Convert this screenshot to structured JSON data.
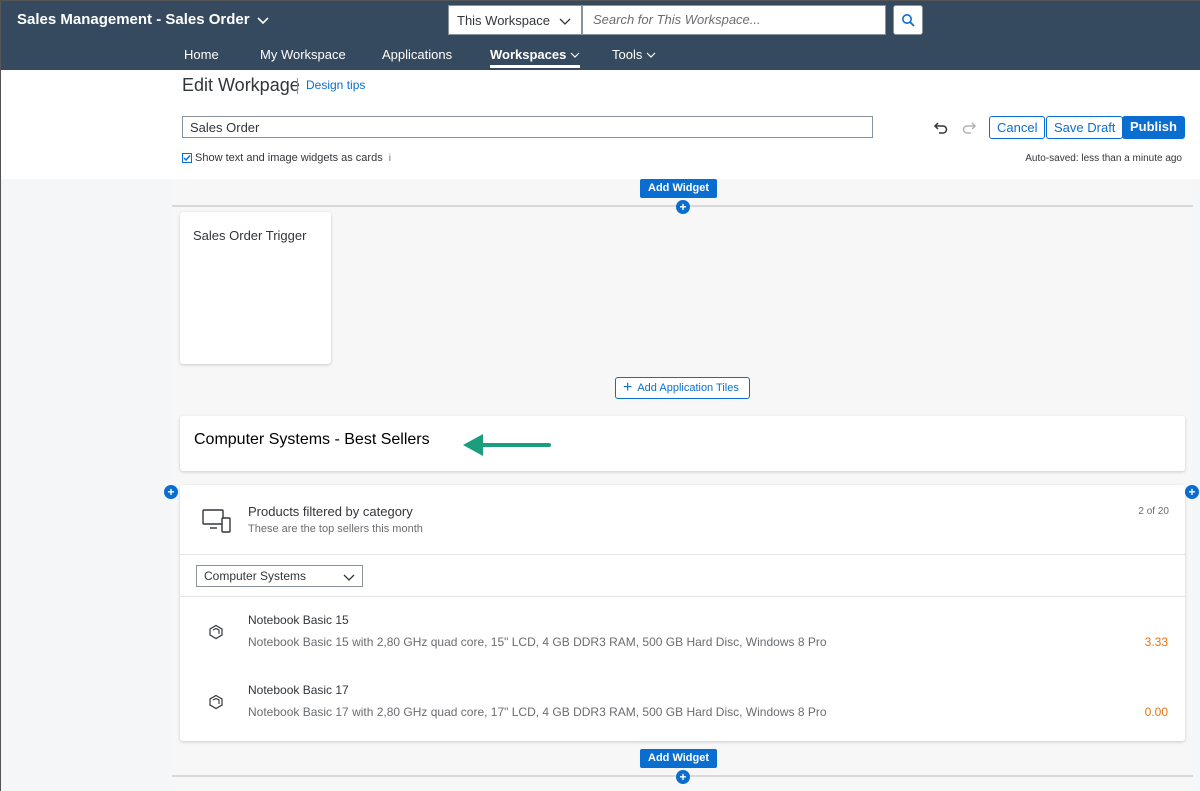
{
  "shell": {
    "app_title": "Sales Management - Sales Order",
    "scope_value": "This Workspace",
    "search_placeholder": "Search for This Workspace...",
    "nav": [
      {
        "label": "Home"
      },
      {
        "label": "My Workspace"
      },
      {
        "label": "Applications"
      },
      {
        "label": "Workspaces",
        "active": true
      },
      {
        "label": "Tools"
      }
    ]
  },
  "editor": {
    "page_title": "Edit Workpage",
    "design_tips": "Design tips",
    "title_value": "Sales Order",
    "cancel": "Cancel",
    "save_draft": "Save Draft",
    "publish": "Publish",
    "checkbox_label": "Show text and image widgets as cards",
    "checkbox_checked": true,
    "info_glyph": "i",
    "autosave": "Auto-saved: less than a minute ago"
  },
  "canvas": {
    "add_widget": "Add Widget",
    "add_tiles": "Add Application Tiles",
    "tile_title": "Sales Order Trigger",
    "section_title": "Computer Systems - Best Sellers",
    "list_card": {
      "title": "Products filtered by category",
      "subtitle": "These are the top sellers this month",
      "count": "2 of 20",
      "filter_value": "Computer Systems",
      "items": [
        {
          "name": "Notebook Basic 15",
          "desc": "Notebook Basic 15 with 2,80 GHz quad core, 15\" LCD, 4 GB DDR3 RAM, 500 GB Hard Disc, Windows 8 Pro",
          "value": "3.33"
        },
        {
          "name": "Notebook Basic 17",
          "desc": "Notebook Basic 17 with 2,80 GHz quad core, 17\" LCD, 4 GB DDR3 RAM, 500 GB Hard Disc, Windows 8 Pro",
          "value": "0.00"
        }
      ]
    }
  },
  "colors": {
    "shell_bg": "#354a5f",
    "accent": "#0a6ed1",
    "value_orange": "#e9730c",
    "arrow_green": "#1a9e7e"
  },
  "icons": {
    "title_chevron": "chevron-down-icon",
    "search": "search-icon",
    "undo": "undo-icon",
    "redo": "redo-icon",
    "list_card": "devices-icon",
    "product": "product-box-icon",
    "annotation_arrow": "left-arrow-icon"
  }
}
